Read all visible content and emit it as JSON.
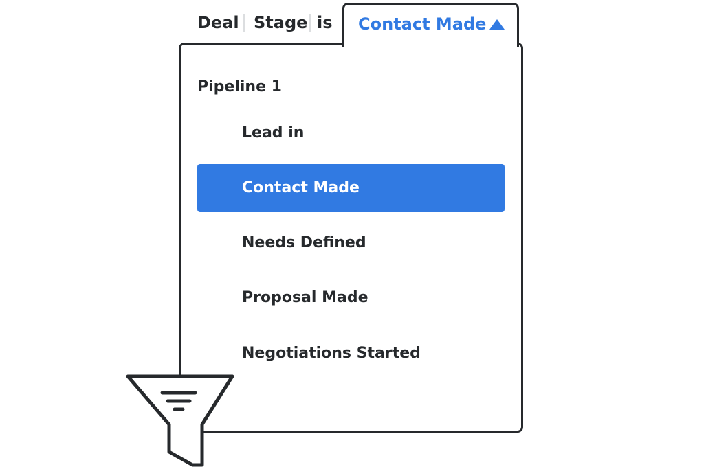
{
  "filter": {
    "field_object": "Deal",
    "field_name": "Stage",
    "operator": "is",
    "selected_value": "Contact Made",
    "dropdown_state": "open"
  },
  "dropdown": {
    "group_label": "Pipeline 1",
    "options": [
      {
        "label": "Lead in",
        "selected": false
      },
      {
        "label": "Contact Made",
        "selected": true
      },
      {
        "label": "Needs Defined",
        "selected": false
      },
      {
        "label": "Proposal Made",
        "selected": false
      },
      {
        "label": "Negotiations Started",
        "selected": false
      }
    ]
  },
  "icons": {
    "caret": "caret-up-icon",
    "funnel": "funnel-filter-icon"
  },
  "colors": {
    "accent": "#317ae2",
    "text": "#26292c",
    "separator": "#dcdee0",
    "selected_text": "#ffffff"
  }
}
